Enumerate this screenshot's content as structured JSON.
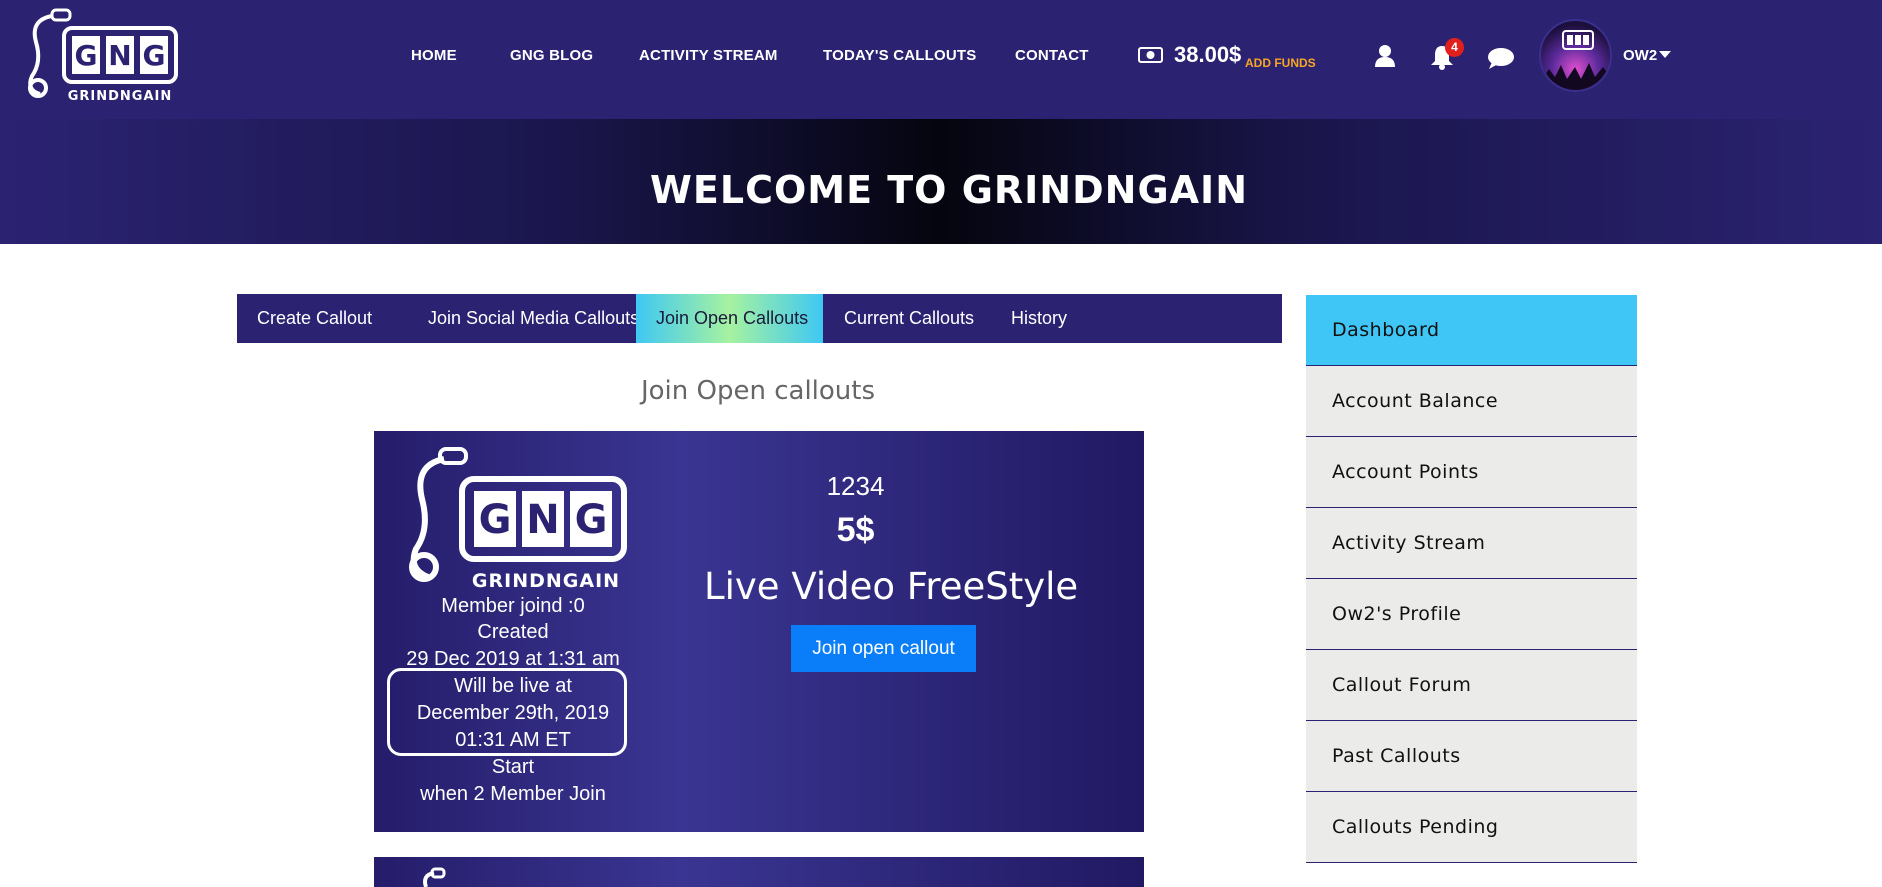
{
  "brand": {
    "logo_text": "GNG",
    "logo_sub": "GRINDNGAIN"
  },
  "nav": {
    "home": "HOME",
    "blog": "GNG BLOG",
    "activity": "ACTIVITY STREAM",
    "today": "TODAY'S CALLOUTS",
    "contact": "CONTACT"
  },
  "wallet": {
    "balance": "38.00$",
    "add_funds": "ADD FUNDS"
  },
  "notifications": {
    "count": "4"
  },
  "user": {
    "name": "OW2"
  },
  "hero": {
    "title": "WELCOME TO GRINDNGAIN"
  },
  "tabs": [
    {
      "label": "Create Callout"
    },
    {
      "label": "Join Social Media Callouts"
    },
    {
      "label": "Join Open Callouts"
    },
    {
      "label": "Current Callouts"
    },
    {
      "label": "History"
    }
  ],
  "main": {
    "section_title": "Join Open callouts",
    "card": {
      "members": "Member joind :0",
      "created_label": "Created",
      "created_date": "29 Dec 2019 at 1:31 am",
      "live_l1": "Will be live at",
      "live_l2": "December 29th, 2019",
      "live_l3": "01:31 AM ET",
      "start": "Start",
      "when": "when 2 Member Join",
      "number": "1234",
      "price": "5$",
      "title": "Live Video FreeStyle",
      "join_button": "Join open callout"
    }
  },
  "sidebar": {
    "items": [
      {
        "label": "Dashboard"
      },
      {
        "label": "Account Balance"
      },
      {
        "label": "Account Points"
      },
      {
        "label": "Activity Stream"
      },
      {
        "label": "Ow2's Profile"
      },
      {
        "label": "Callout Forum"
      },
      {
        "label": "Past Callouts"
      },
      {
        "label": "Callouts Pending"
      }
    ]
  },
  "colors": {
    "navbar": "#2b2372",
    "active_tab": "#3fc8f3",
    "sidebar_active": "#3fc6f6",
    "button": "#0a7ef8",
    "add_funds": "#f6a524",
    "badge": "#e0201d"
  }
}
